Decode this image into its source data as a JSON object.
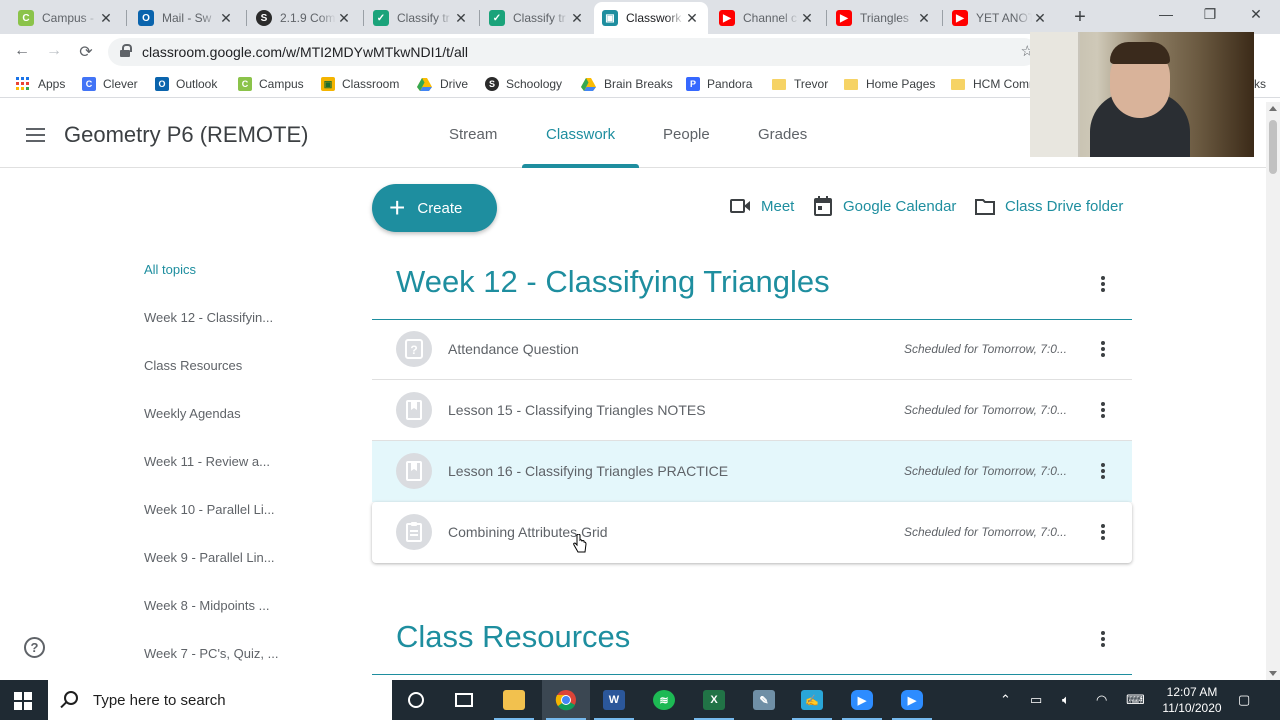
{
  "browser": {
    "tabs": [
      {
        "title": "Campus - ",
        "icon": "campus-icon",
        "color": "#8bc34a",
        "active": false
      },
      {
        "title": "Mail - Sw",
        "icon": "outlook-icon",
        "color": "#0a64ad",
        "active": false
      },
      {
        "title": "2.1.9 Com",
        "icon": "schoology-icon",
        "color": "#2b2b2b",
        "active": false
      },
      {
        "title": "Classify tr",
        "icon": "shield-check-icon",
        "color": "#1aa37a",
        "active": false
      },
      {
        "title": "Classify tr",
        "icon": "shield-check-icon",
        "color": "#1aa37a",
        "active": false
      },
      {
        "title": "Classwork",
        "icon": "classroom-icon",
        "color": "#1e8e9f",
        "active": true
      },
      {
        "title": "Channel c",
        "icon": "youtube-icon",
        "color": "#ff0000",
        "active": false
      },
      {
        "title": "Triangles",
        "icon": "youtube-icon",
        "color": "#ff0000",
        "active": false
      },
      {
        "title": "YET ANOT",
        "icon": "youtube-icon",
        "color": "#ff0000",
        "active": false
      }
    ],
    "url": "classroom.google.com/w/MTI2MDYwMTkwNDI1/t/all",
    "bookmarks": [
      {
        "label": "Apps",
        "icon": "apps-grid-icon"
      },
      {
        "label": "Clever",
        "icon": "clever-icon"
      },
      {
        "label": "Outlook",
        "icon": "outlook-icon"
      },
      {
        "label": "Campus",
        "icon": "campus-icon"
      },
      {
        "label": "Classroom",
        "icon": "classroom-icon"
      },
      {
        "label": "Drive",
        "icon": "drive-icon"
      },
      {
        "label": "Schoology",
        "icon": "schoology-icon"
      },
      {
        "label": "Brain Breaks",
        "icon": "drive-icon"
      },
      {
        "label": "Pandora",
        "icon": "pandora-icon"
      },
      {
        "label": "Trevor",
        "icon": "folder-icon"
      },
      {
        "label": "Home Pages",
        "icon": "folder-icon"
      },
      {
        "label": "HCM Comm",
        "icon": "folder-icon"
      },
      {
        "label": "ks",
        "icon": "folder-icon"
      }
    ]
  },
  "classroom": {
    "class_title": "Geometry P6 (REMOTE)",
    "nav": [
      "Stream",
      "Classwork",
      "People",
      "Grades"
    ],
    "active_nav": "Classwork",
    "create_label": "Create",
    "meet_label": "Meet",
    "calendar_label": "Google Calendar",
    "drive_label": "Class Drive folder",
    "topics": [
      "All topics",
      "Week 12 - Classifyin...",
      "Class Resources",
      "Weekly Agendas",
      "Week 11 - Review a...",
      "Week 10 - Parallel Li...",
      "Week 9 - Parallel Lin...",
      "Week 8 - Midpoints ...",
      "Week 7 - PC's, Quiz, ..."
    ],
    "sections": [
      {
        "title": "Week 12 - Classifying Triangles",
        "items": [
          {
            "name": "Attendance Question",
            "status": "Scheduled for Tomorrow, 7:0...",
            "icon": "question-icon"
          },
          {
            "name": "Lesson 15 - Classifying Triangles NOTES",
            "status": "Scheduled for Tomorrow, 7:0...",
            "icon": "material-icon"
          },
          {
            "name": "Lesson 16 - Classifying Triangles PRACTICE",
            "status": "Scheduled for Tomorrow, 7:0...",
            "icon": "material-icon"
          },
          {
            "name": "Combining Attributes Grid",
            "status": "Scheduled for Tomorrow, 7:0...",
            "icon": "assignment-icon"
          }
        ]
      },
      {
        "title": "Class Resources",
        "items": []
      }
    ],
    "accent_color": "#1e8e9f"
  },
  "taskbar": {
    "search_placeholder": "Type here to search",
    "time": "12:07 AM",
    "date": "11/10/2020",
    "apps": [
      "cortana-icon",
      "task-view-icon",
      "file-explorer-icon",
      "chrome-icon",
      "word-icon",
      "spotify-icon",
      "excel-icon",
      "paint-icon",
      "notepad-icon",
      "zoom-icon",
      "zoom-icon"
    ]
  }
}
